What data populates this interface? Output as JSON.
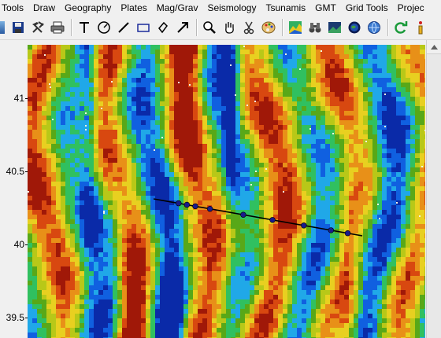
{
  "menu": [
    "Tools",
    "Draw",
    "Geography",
    "Plates",
    "Mag/Grav",
    "Seismology",
    "Tsunamis",
    "GMT",
    "Grid Tools",
    "Projec"
  ],
  "toolbar": {
    "buttons": [
      "save-icon",
      "hammer-pick-icon",
      "print-icon",
      "text-icon",
      "compass-icon",
      "line-icon",
      "rectangle-icon",
      "polygon-icon",
      "arrow-icon",
      "zoom-icon",
      "pan-hand-icon",
      "scissors-icon",
      "palette-icon",
      "shaded-relief-icon",
      "binoculars-icon",
      "image-icon",
      "earth-icon",
      "globe-icon",
      "refresh-icon",
      "info-icon"
    ]
  },
  "axes": {
    "y_ticks": [
      "41",
      "40.5",
      "40",
      "39.5"
    ]
  },
  "profile_track": {
    "color": "#000000",
    "vertex_color": "#1a1a8c",
    "vertex_count": 9
  },
  "colors": {
    "colormap": [
      "#0a2aa8",
      "#1060e0",
      "#20a8e8",
      "#30c060",
      "#58a818",
      "#b8c818",
      "#e8d020",
      "#e89018",
      "#d84810",
      "#a01808"
    ]
  }
}
